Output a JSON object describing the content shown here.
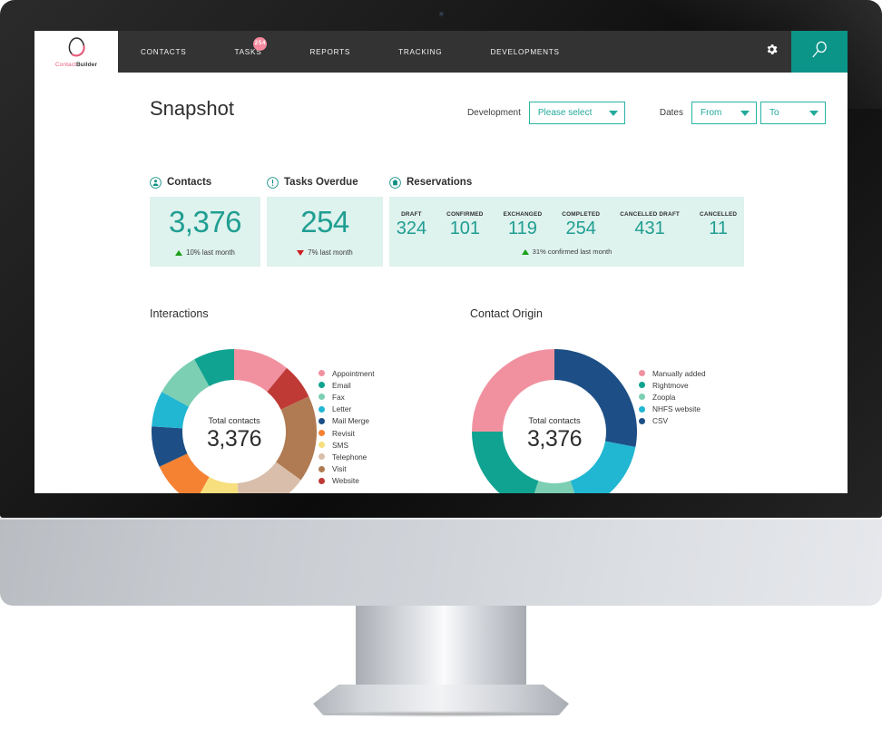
{
  "nav": {
    "logo": {
      "name_a": "Contact",
      "name_b": "Builder",
      "icon": "egg-logo-icon"
    },
    "items": [
      {
        "label": "CONTACTS",
        "badge": null
      },
      {
        "label": "TASKS",
        "badge": "254"
      },
      {
        "label": "REPORTS",
        "badge": null
      },
      {
        "label": "TRACKING",
        "badge": null
      },
      {
        "label": "DEVELOPMENTS",
        "badge": null
      }
    ],
    "gear_icon": "gear-icon",
    "search_icon": "search-icon",
    "badge_color": "#f58a9e",
    "bar_color": "#333333",
    "search_color": "#0b9488"
  },
  "header": {
    "title": "Snapshot",
    "development_label": "Development",
    "development_value": "Please select",
    "dates_label": "Dates",
    "date_from": "From",
    "date_to": "To",
    "accent": "#23a99a"
  },
  "kpis": {
    "contacts": {
      "title": "Contacts",
      "icon": "person-circle-icon",
      "value": "3,376",
      "trend_dir": "up",
      "trend_text": "10% last month"
    },
    "tasks_overdue": {
      "title": "Tasks Overdue",
      "icon": "exclamation-circle-icon",
      "value": "254",
      "trend_dir": "down",
      "trend_text": "7% last month"
    },
    "reservations": {
      "title": "Reservations",
      "icon": "home-circle-icon",
      "cells": [
        {
          "label": "DRAFT",
          "value": "324"
        },
        {
          "label": "CONFIRMED",
          "value": "101"
        },
        {
          "label": "EXCHANGED",
          "value": "119"
        },
        {
          "label": "COMPLETED",
          "value": "254"
        },
        {
          "label": "CANCELLED DRAFT",
          "value": "431"
        },
        {
          "label": "CANCELLED",
          "value": "11"
        }
      ],
      "trend_dir": "up",
      "trend_text": "31% confirmed last month"
    },
    "panel_bg": "#def2ee",
    "value_color": "#1f9e91",
    "up_color": "#1aa01a",
    "down_color": "#cc1b1b"
  },
  "chart_data": [
    {
      "type": "pie",
      "id": "interactions",
      "title": "Interactions",
      "center_label": "Total contacts",
      "center_value": "3,376",
      "legend_position": "right",
      "categories": [
        "Appointment",
        "Email",
        "Fax",
        "Letter",
        "Mail Merge",
        "Revisit",
        "SMS",
        "Telephone",
        "Visit",
        "Website"
      ],
      "colors": [
        "#f1919f",
        "#11a391",
        "#7ccfb2",
        "#21b6d2",
        "#1d4f86",
        "#f58233",
        "#f7df7e",
        "#d9bfab",
        "#b07b52",
        "#bf3a35"
      ],
      "values": [
        11,
        8,
        9,
        7,
        8,
        10,
        9,
        14,
        17,
        7
      ],
      "draw_order": [
        "Appointment",
        "Website",
        "Visit",
        "Telephone",
        "SMS",
        "Revisit",
        "Mail Merge",
        "Letter",
        "Fax",
        "Email"
      ]
    },
    {
      "type": "pie",
      "id": "contact-origin",
      "title": "Contact Origin",
      "center_label": "Total contacts",
      "center_value": "3,376",
      "legend_position": "right",
      "categories": [
        "Manually added",
        "Rightmove",
        "Zoopla",
        "NHFS website",
        "CSV"
      ],
      "colors": [
        "#f1919f",
        "#11a391",
        "#7ccfb2",
        "#21b6d2",
        "#1d4f86"
      ],
      "values": [
        25,
        20,
        10,
        17,
        28
      ],
      "draw_order": [
        "CSV",
        "NHFS website",
        "Zoopla",
        "Rightmove",
        "Manually added"
      ]
    }
  ]
}
